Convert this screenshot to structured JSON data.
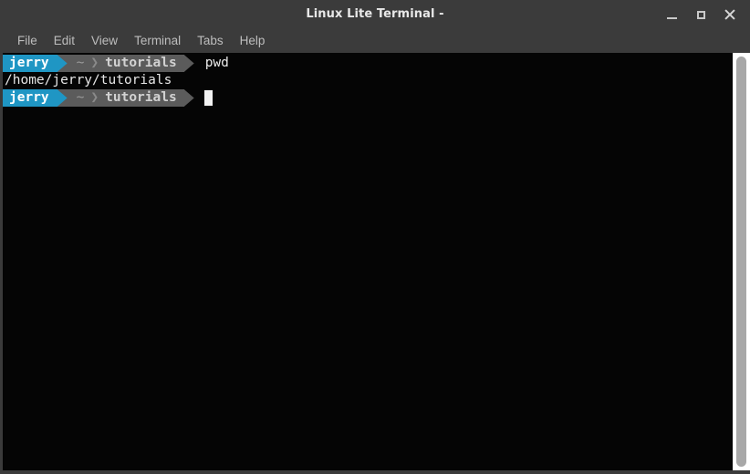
{
  "window": {
    "title": "Linux Lite Terminal -",
    "controls": [
      {
        "name": "minimize-button",
        "glyph": "_",
        "label": "Minimize"
      },
      {
        "name": "maximize-button",
        "glyph": "□",
        "label": "Maximize"
      },
      {
        "name": "close-button",
        "glyph": "×",
        "label": "Close"
      }
    ]
  },
  "menubar": {
    "items": [
      {
        "label": "File"
      },
      {
        "label": "Edit"
      },
      {
        "label": "View"
      },
      {
        "label": "Terminal"
      },
      {
        "label": "Tabs"
      },
      {
        "label": "Help"
      }
    ]
  },
  "terminal": {
    "background": "#050505",
    "foreground": "#e6e6e6",
    "prompt": {
      "user": "jerry",
      "user_bg": "#1f96c4",
      "user_fg": "#ffffff",
      "path_bg": "#5b5b5b",
      "home_symbol": "~",
      "separator": "❯",
      "directory": "tutorials"
    },
    "lines": [
      {
        "type": "prompt",
        "command": "pwd"
      },
      {
        "type": "output",
        "text": "/home/jerry/tutorials"
      },
      {
        "type": "prompt",
        "command": "",
        "cursor": true
      }
    ],
    "scrollbar": {
      "track_color": "#ffffff",
      "thumb_color": "#a8a8a8"
    }
  }
}
